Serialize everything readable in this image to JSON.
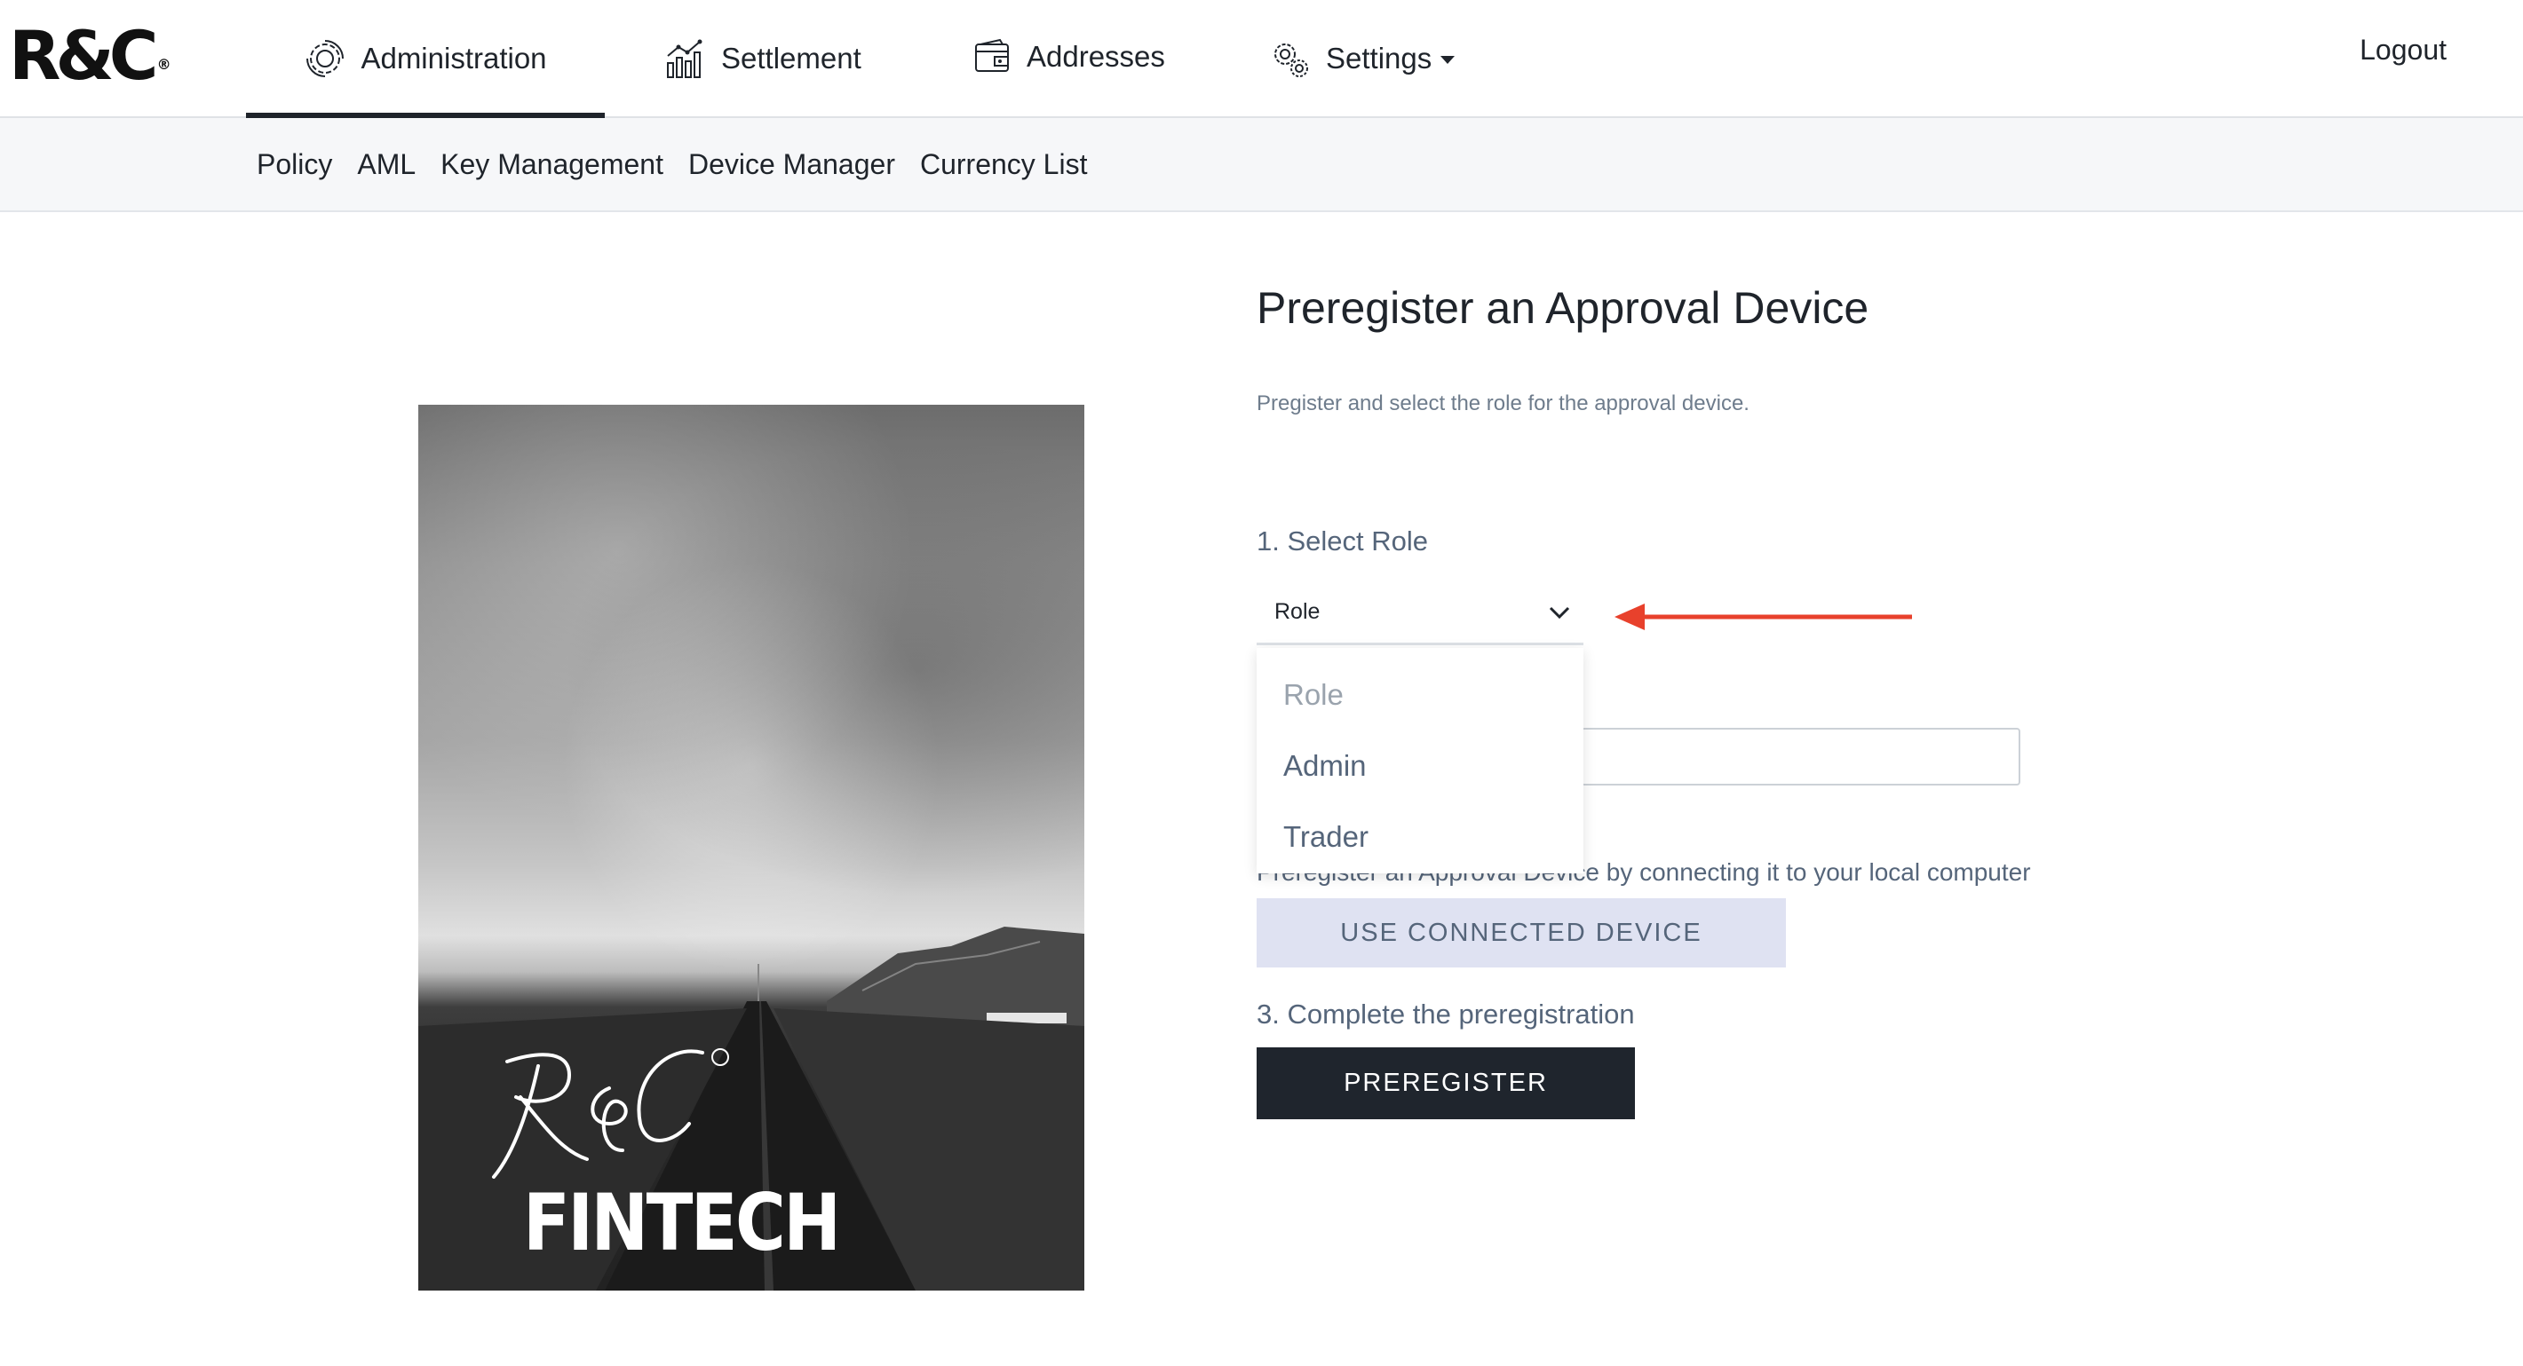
{
  "brand": {
    "logo_text": "R&C",
    "logo_mark": "®"
  },
  "topnav": {
    "tabs": [
      {
        "label": "Administration",
        "icon": "administration-icon",
        "active": true
      },
      {
        "label": "Settlement",
        "icon": "settlement-chart-icon",
        "active": false
      },
      {
        "label": "Addresses",
        "icon": "addresses-wallet-icon",
        "active": false
      },
      {
        "label": "Settings",
        "icon": "settings-gear-icon",
        "active": false,
        "has_dropdown": true
      }
    ],
    "logout_label": "Logout"
  },
  "subnav": {
    "items": [
      "Policy",
      "AML",
      "Key Management",
      "Device Manager",
      "Currency List"
    ]
  },
  "hero_image": {
    "script_text": "R&C",
    "wordmark": "FINTECH"
  },
  "form": {
    "title": "Preregister an Approval Device",
    "description": "Pregister and select the role for the approval device.",
    "step1_label": "1. Select Role",
    "role_select_value": "Role",
    "role_options": [
      "Role",
      "Admin",
      "Trader"
    ],
    "step2_text": "Preregister an Approval Device by connecting it to your local computer",
    "use_connected_label": "USE CONNECTED DEVICE",
    "step3_label": "3. Complete the preregistration",
    "preregister_label": "PREREGISTER"
  },
  "colors": {
    "annotation_arrow": "#e8412c",
    "primary_button": "#1f252d",
    "secondary_button": "#dfe2f2",
    "muted_text": "#55657a"
  }
}
